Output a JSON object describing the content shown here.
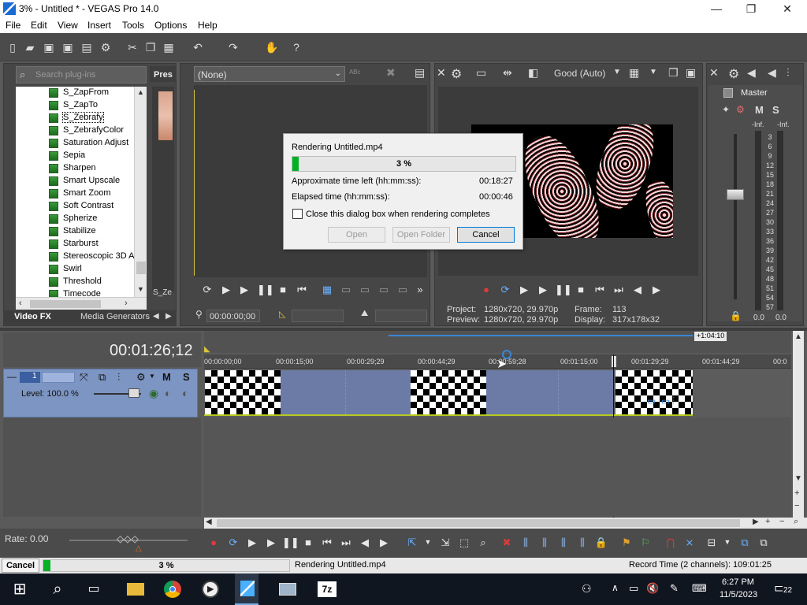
{
  "window": {
    "title": "3% - Untitled * - VEGAS Pro 14.0"
  },
  "menu": [
    "File",
    "Edit",
    "View",
    "Insert",
    "Tools",
    "Options",
    "Help"
  ],
  "plugins": {
    "search_placeholder": "Search plug-ins",
    "items": [
      "S_ZapFrom",
      "S_ZapTo",
      "S_Zebrafy",
      "S_ZebrafyColor",
      "Saturation Adjust",
      "Sepia",
      "Sharpen",
      "Smart Upscale",
      "Smart Zoom",
      "Soft Contrast",
      "Spherize",
      "Stabilize",
      "Starburst",
      "Stereoscopic 3D A",
      "Swirl",
      "Threshold",
      "Timecode"
    ],
    "selected": "S_Zebrafy",
    "presets_label": "Pres",
    "preset_thumb_label": "S_Ze",
    "tabs": [
      "Video FX",
      "Media Generators"
    ]
  },
  "trimmer": {
    "dropdown_value": "(None)",
    "timecode": "00:00:00;00"
  },
  "preview": {
    "quality": "Good (Auto)",
    "project_label": "Project:",
    "project_value": "1280x720, 29.970p",
    "preview_label": "Preview:",
    "preview_value": "1280x720, 29.970p",
    "frame_label": "Frame:",
    "frame_value": "113",
    "display_label": "Display:",
    "display_value": "317x178x32"
  },
  "mixer": {
    "title": "Master",
    "m_label": "M",
    "s_label": "S",
    "inf_left": "-Inf.",
    "inf_right": "-Inf.",
    "scale": [
      "3",
      "6",
      "9",
      "12",
      "15",
      "18",
      "21",
      "24",
      "27",
      "30",
      "33",
      "36",
      "39",
      "42",
      "45",
      "48",
      "51",
      "54",
      "57"
    ],
    "val_left": "0.0",
    "val_right": "0.0"
  },
  "render_dialog": {
    "title": "Rendering Untitled.mp4",
    "percent": "3 %",
    "progress": 0.03,
    "time_left_label": "Approximate time left (hh:mm:ss):",
    "time_left_value": "00:18:27",
    "elapsed_label": "Elapsed time (hh:mm:ss):",
    "elapsed_value": "00:00:46",
    "close_checkbox_label": "Close this dialog box when rendering completes",
    "open_button": "Open",
    "open_folder_button": "Open Folder",
    "cancel_button": "Cancel"
  },
  "timeline": {
    "position": "00:01:26;12",
    "loop_end": "+1:04:10",
    "ruler": [
      "00:00:00;00",
      "00:00:15;00",
      "00:00:29;29",
      "00:00:44;29",
      "00:00:59;28",
      "00:01:15;00",
      "00:01:29;29",
      "00:01:44;29",
      "00:0"
    ],
    "track_number": "1",
    "track_m": "M",
    "track_s": "S",
    "level": "Level: 100.0 %"
  },
  "bottom": {
    "rate": "Rate: 0.00"
  },
  "statusbar": {
    "cancel": "Cancel",
    "percent": "3 %",
    "progress": 0.03,
    "message": "Rendering Untitled.mp4",
    "record_time": "Record Time (2 channels): 109:01:25"
  },
  "taskbar": {
    "time": "6:27 PM",
    "date": "11/5/2023",
    "notifications": "22",
    "zip_label": "7z"
  },
  "colors": {
    "progress_green": "#06b025",
    "track_blue": "#7c95c2",
    "accent": "#0078d7"
  }
}
